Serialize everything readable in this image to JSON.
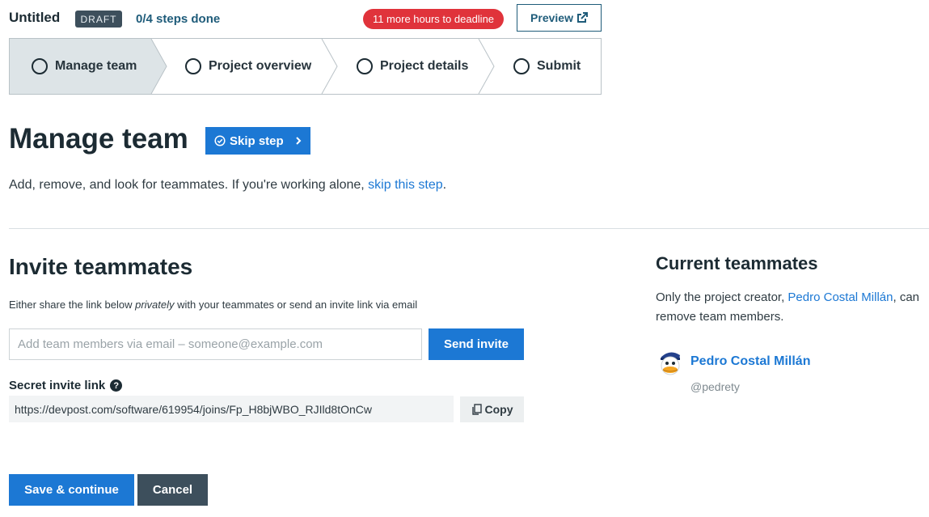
{
  "header": {
    "title": "Untitled",
    "status_badge": "DRAFT",
    "progress": "0/4 steps done",
    "deadline": "11 more hours to deadline",
    "preview_label": "Preview"
  },
  "stepper": {
    "steps": [
      {
        "label": "Manage team",
        "active": true
      },
      {
        "label": "Project overview",
        "active": false
      },
      {
        "label": "Project details",
        "active": false
      },
      {
        "label": "Submit",
        "active": false
      }
    ]
  },
  "main": {
    "heading": "Manage team",
    "skip_label": "Skip step",
    "description_prefix": "Add, remove, and look for teammates. If you're working alone, ",
    "description_link": "skip this step",
    "description_suffix": "."
  },
  "invite": {
    "heading": "Invite teammates",
    "desc_prefix": "Either share the link below ",
    "desc_emphasis": "privately",
    "desc_suffix": " with your teammates or send an invite link via email",
    "email_placeholder": "Add team members via email – someone@example.com",
    "email_value": "",
    "send_label": "Send invite",
    "secret_label": "Secret invite link",
    "help_glyph": "?",
    "secret_link": "https://devpost.com/software/619954/joins/Fp_H8bjWBO_RJIld8tOnCw",
    "copy_label": "Copy"
  },
  "current": {
    "heading": "Current teammates",
    "desc_prefix": "Only the project creator, ",
    "desc_link": "Pedro Costal Millán",
    "desc_suffix": ", can remove team members.",
    "members": [
      {
        "name": "Pedro Costal Millán",
        "handle": "@pedrety"
      }
    ]
  },
  "footer": {
    "save_label": "Save & continue",
    "cancel_label": "Cancel"
  },
  "colors": {
    "primary": "#1c78d4",
    "dark": "#3d4f5c",
    "danger": "#e0333b",
    "active_step_bg": "#dde4e7"
  },
  "icons": [
    "external-link-icon",
    "check-circle-icon",
    "chevron-right-icon",
    "help-icon",
    "copy-icon",
    "avatar-duck-icon"
  ]
}
